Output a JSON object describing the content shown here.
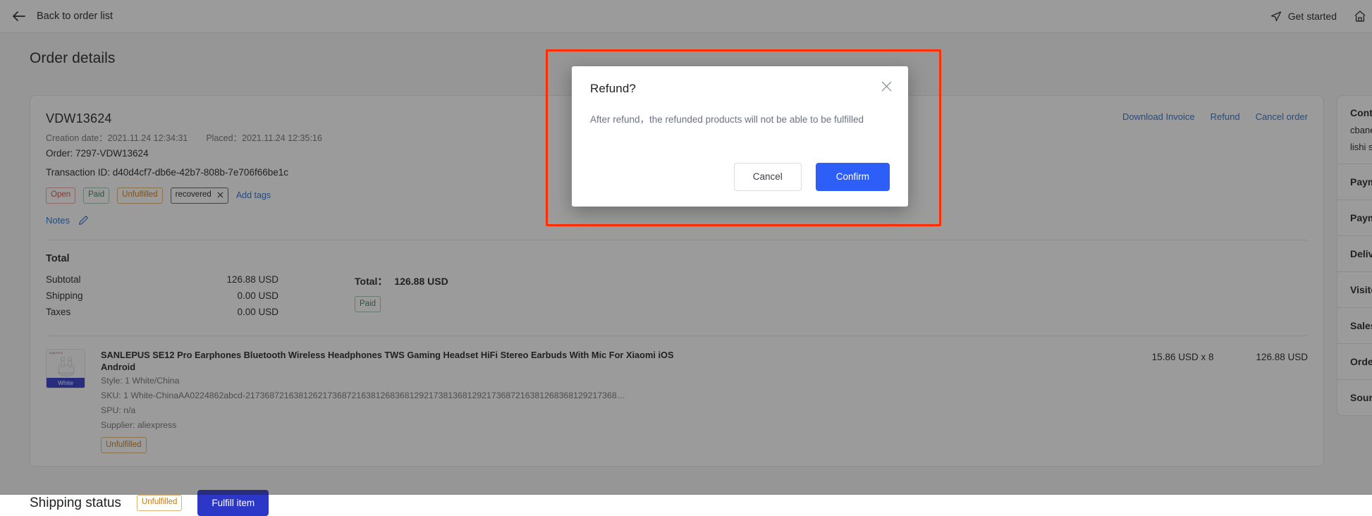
{
  "topbar": {
    "back_label": "Back to order list",
    "back_icon": "arrow-left-icon",
    "get_started_label": "Get started",
    "get_started_icon": "send-icon",
    "home_icon": "home-icon"
  },
  "page_title": "Order details",
  "order": {
    "number": "VDW13624",
    "creation_date_label": "Creation date：",
    "creation_date_value": "2021.11.24 12:34:31",
    "placed_label": "Placed：",
    "placed_value": "2021.11.24 12:35:16",
    "order_line": "Order: 7297-VDW13624",
    "transaction_line": "Transaction ID: d40d4cf7-db6e-42b7-808b-7e706f66be1c",
    "badges": [
      {
        "label": "Open",
        "style": "open"
      },
      {
        "label": "Paid",
        "style": "paid"
      },
      {
        "label": "Unfulfilled",
        "style": "unfulfilled"
      }
    ],
    "tag": {
      "label": "recovered",
      "remove_icon": "close-icon"
    },
    "add_tags_label": "Add tags",
    "notes_label": "Notes",
    "notes_edit_icon": "pencil-icon",
    "actions": [
      {
        "label": "Download Invoice"
      },
      {
        "label": "Refund"
      },
      {
        "label": "Cancel order"
      }
    ]
  },
  "totals": {
    "heading": "Total",
    "rows": [
      {
        "label": "Subtotal",
        "value": "126.88 USD"
      },
      {
        "label": "Shipping",
        "value": "0.00 USD"
      },
      {
        "label": "Taxes",
        "value": "0.00 USD"
      }
    ],
    "grand_label": "Total：",
    "grand_value": "126.88 USD",
    "paid_badge": "Paid"
  },
  "product": {
    "thumb_brand": "SANLEPUS",
    "thumb_caption": "White",
    "title": "SANLEPUS SE12 Pro Earphones Bluetooth Wireless Headphones TWS Gaming Headset HiFi Stereo Earbuds With Mic For Xiaomi iOS Android",
    "style": "Style: 1 White/China",
    "sku": "SKU: 1 White-ChinaAA0224862abcd-21736872163812621736872163812683681292173813681292173687216381268368129217368…",
    "spu": "SPU: n/a",
    "supplier": "Supplier: aliexpress",
    "fulfill_badge": "Unfulfilled",
    "unit_price": "15.86 USD x 8",
    "line_total": "126.88 USD"
  },
  "shipping": {
    "title": "Shipping status",
    "badge": "Unfulfilled",
    "fulfill_button": "Fulfill item"
  },
  "side_panel": {
    "customer_title": "Contact information",
    "customer_email": "cbanerjee@example.com",
    "customer_sub": "lishi store",
    "items": [
      {
        "label": "Payment status"
      },
      {
        "label": "Payment method"
      },
      {
        "label": "Delivery method"
      },
      {
        "label": "Visitor details"
      },
      {
        "label": "Sales channel"
      },
      {
        "label": "Order source"
      },
      {
        "label": "Source details"
      }
    ]
  },
  "modal": {
    "title": "Refund?",
    "body": "After refund，the refunded products will not be able to be fulfilled",
    "close_icon": "close-icon",
    "cancel_label": "Cancel",
    "confirm_label": "Confirm",
    "confirm_color": "#2d5ef7"
  },
  "annotation": {
    "highlight_color": "#ff2d00"
  }
}
